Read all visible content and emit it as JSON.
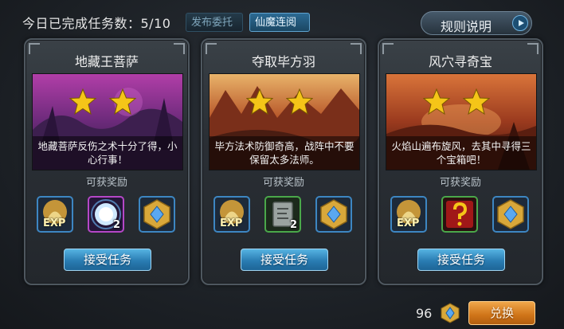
{
  "header": {
    "count_label": "今日已完成任务数：5/10",
    "tab_publish": "发布委托",
    "tab_immortal": "仙魔连阅",
    "rules_label": "规则说明"
  },
  "cards": [
    {
      "title": "地藏王菩萨",
      "stars": 2,
      "desc": "地藏菩萨反伤之术十分了得，小心行事！",
      "reward_label": "可获奖励",
      "rewards": [
        {
          "icon": "exp-icon",
          "label": "EXP",
          "count": ""
        },
        {
          "icon": "light-orb-icon",
          "label": "",
          "count": "2"
        },
        {
          "icon": "blue-gem-icon",
          "label": "",
          "count": ""
        }
      ],
      "accept_label": "接受任务"
    },
    {
      "title": "夺取毕方羽",
      "stars": 2,
      "desc": "毕方法术防御奇高，战阵中不要保留太多法师。",
      "reward_label": "可获奖励",
      "rewards": [
        {
          "icon": "exp-icon",
          "label": "EXP",
          "count": ""
        },
        {
          "icon": "scroll-icon",
          "label": "",
          "count": "2"
        },
        {
          "icon": "blue-gem-icon",
          "label": "",
          "count": ""
        }
      ],
      "accept_label": "接受任务"
    },
    {
      "title": "风穴寻奇宝",
      "stars": 2,
      "desc": "火焰山遍布旋风，去其中寻得三个宝箱吧！",
      "reward_label": "可获奖励",
      "rewards": [
        {
          "icon": "exp-icon",
          "label": "EXP",
          "count": ""
        },
        {
          "icon": "mystery-item-icon",
          "label": "",
          "count": ""
        },
        {
          "icon": "blue-gem-icon",
          "label": "",
          "count": ""
        }
      ],
      "accept_label": "接受任务"
    }
  ],
  "footer": {
    "currency_count": "96",
    "currency_icon": "blue-gem-icon",
    "exchange_label": "兑换"
  },
  "colors": {
    "accept_button": "#2a7db3",
    "exchange_button": "#cf7418",
    "star": "#f5c518"
  }
}
